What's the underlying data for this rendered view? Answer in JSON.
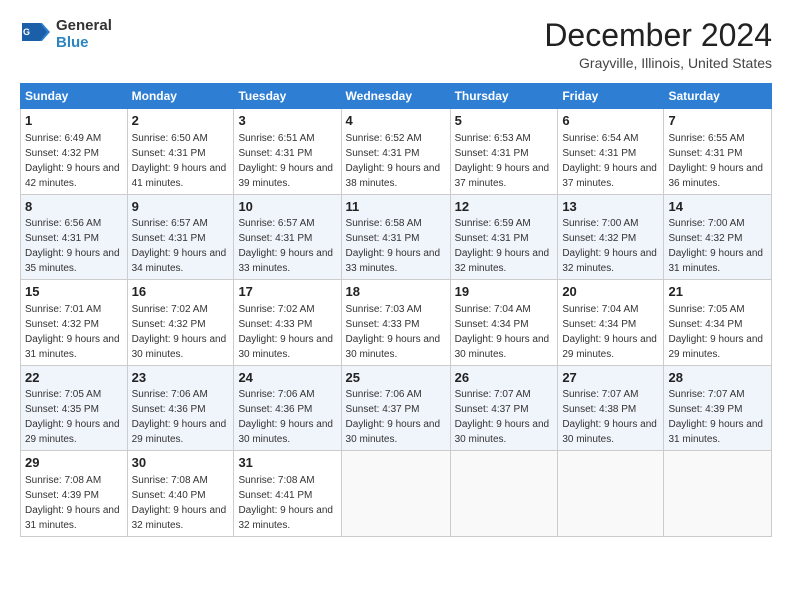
{
  "header": {
    "logo_general": "General",
    "logo_blue": "Blue",
    "month_title": "December 2024",
    "location": "Grayville, Illinois, United States"
  },
  "columns": [
    "Sunday",
    "Monday",
    "Tuesday",
    "Wednesday",
    "Thursday",
    "Friday",
    "Saturday"
  ],
  "weeks": [
    [
      {
        "day": "1",
        "sunrise": "6:49 AM",
        "sunset": "4:32 PM",
        "daylight": "9 hours and 42 minutes."
      },
      {
        "day": "2",
        "sunrise": "6:50 AM",
        "sunset": "4:31 PM",
        "daylight": "9 hours and 41 minutes."
      },
      {
        "day": "3",
        "sunrise": "6:51 AM",
        "sunset": "4:31 PM",
        "daylight": "9 hours and 39 minutes."
      },
      {
        "day": "4",
        "sunrise": "6:52 AM",
        "sunset": "4:31 PM",
        "daylight": "9 hours and 38 minutes."
      },
      {
        "day": "5",
        "sunrise": "6:53 AM",
        "sunset": "4:31 PM",
        "daylight": "9 hours and 37 minutes."
      },
      {
        "day": "6",
        "sunrise": "6:54 AM",
        "sunset": "4:31 PM",
        "daylight": "9 hours and 37 minutes."
      },
      {
        "day": "7",
        "sunrise": "6:55 AM",
        "sunset": "4:31 PM",
        "daylight": "9 hours and 36 minutes."
      }
    ],
    [
      {
        "day": "8",
        "sunrise": "6:56 AM",
        "sunset": "4:31 PM",
        "daylight": "9 hours and 35 minutes."
      },
      {
        "day": "9",
        "sunrise": "6:57 AM",
        "sunset": "4:31 PM",
        "daylight": "9 hours and 34 minutes."
      },
      {
        "day": "10",
        "sunrise": "6:57 AM",
        "sunset": "4:31 PM",
        "daylight": "9 hours and 33 minutes."
      },
      {
        "day": "11",
        "sunrise": "6:58 AM",
        "sunset": "4:31 PM",
        "daylight": "9 hours and 33 minutes."
      },
      {
        "day": "12",
        "sunrise": "6:59 AM",
        "sunset": "4:31 PM",
        "daylight": "9 hours and 32 minutes."
      },
      {
        "day": "13",
        "sunrise": "7:00 AM",
        "sunset": "4:32 PM",
        "daylight": "9 hours and 32 minutes."
      },
      {
        "day": "14",
        "sunrise": "7:00 AM",
        "sunset": "4:32 PM",
        "daylight": "9 hours and 31 minutes."
      }
    ],
    [
      {
        "day": "15",
        "sunrise": "7:01 AM",
        "sunset": "4:32 PM",
        "daylight": "9 hours and 31 minutes."
      },
      {
        "day": "16",
        "sunrise": "7:02 AM",
        "sunset": "4:32 PM",
        "daylight": "9 hours and 30 minutes."
      },
      {
        "day": "17",
        "sunrise": "7:02 AM",
        "sunset": "4:33 PM",
        "daylight": "9 hours and 30 minutes."
      },
      {
        "day": "18",
        "sunrise": "7:03 AM",
        "sunset": "4:33 PM",
        "daylight": "9 hours and 30 minutes."
      },
      {
        "day": "19",
        "sunrise": "7:04 AM",
        "sunset": "4:34 PM",
        "daylight": "9 hours and 30 minutes."
      },
      {
        "day": "20",
        "sunrise": "7:04 AM",
        "sunset": "4:34 PM",
        "daylight": "9 hours and 29 minutes."
      },
      {
        "day": "21",
        "sunrise": "7:05 AM",
        "sunset": "4:34 PM",
        "daylight": "9 hours and 29 minutes."
      }
    ],
    [
      {
        "day": "22",
        "sunrise": "7:05 AM",
        "sunset": "4:35 PM",
        "daylight": "9 hours and 29 minutes."
      },
      {
        "day": "23",
        "sunrise": "7:06 AM",
        "sunset": "4:36 PM",
        "daylight": "9 hours and 29 minutes."
      },
      {
        "day": "24",
        "sunrise": "7:06 AM",
        "sunset": "4:36 PM",
        "daylight": "9 hours and 30 minutes."
      },
      {
        "day": "25",
        "sunrise": "7:06 AM",
        "sunset": "4:37 PM",
        "daylight": "9 hours and 30 minutes."
      },
      {
        "day": "26",
        "sunrise": "7:07 AM",
        "sunset": "4:37 PM",
        "daylight": "9 hours and 30 minutes."
      },
      {
        "day": "27",
        "sunrise": "7:07 AM",
        "sunset": "4:38 PM",
        "daylight": "9 hours and 30 minutes."
      },
      {
        "day": "28",
        "sunrise": "7:07 AM",
        "sunset": "4:39 PM",
        "daylight": "9 hours and 31 minutes."
      }
    ],
    [
      {
        "day": "29",
        "sunrise": "7:08 AM",
        "sunset": "4:39 PM",
        "daylight": "9 hours and 31 minutes."
      },
      {
        "day": "30",
        "sunrise": "7:08 AM",
        "sunset": "4:40 PM",
        "daylight": "9 hours and 32 minutes."
      },
      {
        "day": "31",
        "sunrise": "7:08 AM",
        "sunset": "4:41 PM",
        "daylight": "9 hours and 32 minutes."
      },
      null,
      null,
      null,
      null
    ]
  ],
  "labels": {
    "sunrise": "Sunrise:",
    "sunset": "Sunset:",
    "daylight": "Daylight:"
  }
}
